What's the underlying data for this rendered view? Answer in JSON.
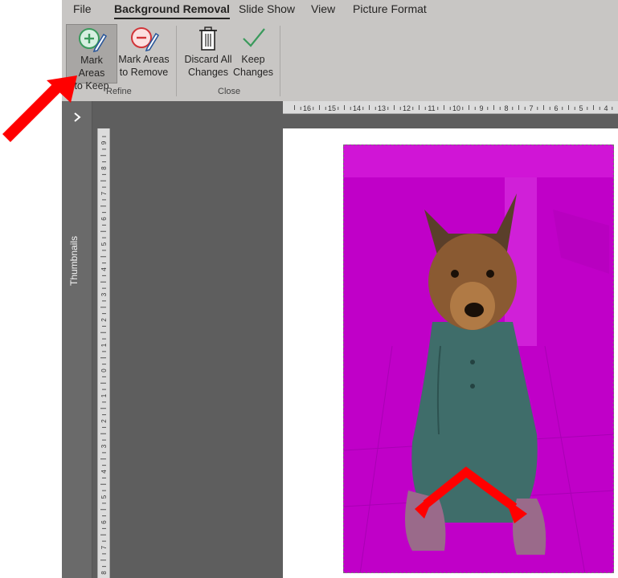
{
  "ribbon": {
    "tabs": [
      "File",
      "Background Removal",
      "Slide Show",
      "View",
      "Picture Format"
    ],
    "active_tab": "Background Removal",
    "groups": {
      "refine": {
        "label": "Refine",
        "mark_keep": "Mark Areas\nto Keep",
        "mark_remove": "Mark Areas\nto Remove"
      },
      "close": {
        "label": "Close",
        "discard": "Discard All\nChanges",
        "keep": "Keep\nChanges"
      }
    }
  },
  "thumbnails_pane": {
    "label": "Thumbnails"
  },
  "rulers": {
    "horizontal_numbers": [
      "16",
      "15",
      "14",
      "13",
      "12",
      "11",
      "10",
      "9",
      "8",
      "7",
      "6",
      "5",
      "4"
    ],
    "vertical_numbers": [
      "9",
      "8",
      "7",
      "6",
      "5",
      "4",
      "3",
      "2",
      "1",
      "0",
      "1",
      "2",
      "3",
      "4",
      "5",
      "6",
      "7",
      "8"
    ]
  },
  "colors": {
    "ribbon_bg": "#c8c6c4",
    "removal_overlay": "#c000c8",
    "annotation_arrow": "#ff0000"
  },
  "icons": {
    "mark_keep": "pencil-plus-icon",
    "mark_remove": "pencil-minus-icon",
    "discard": "trash-icon",
    "keep": "checkmark-icon",
    "pane_toggle": "chevron-right-icon"
  }
}
